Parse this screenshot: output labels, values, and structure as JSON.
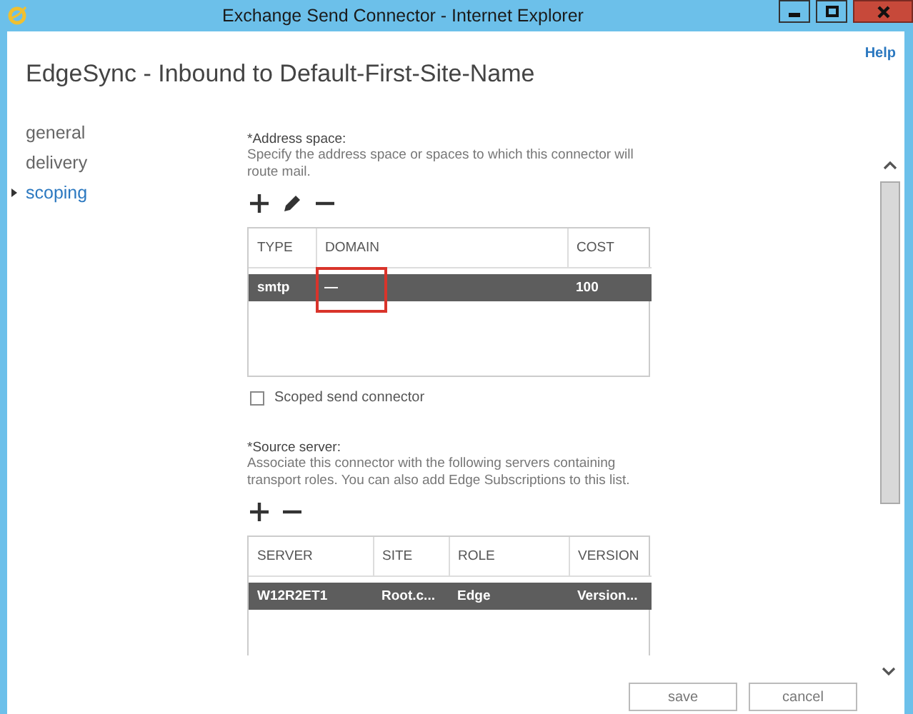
{
  "window": {
    "title": "Exchange Send Connector - Internet Explorer",
    "controls": [
      {
        "kind": "minimize"
      },
      {
        "kind": "maximize"
      },
      {
        "kind": "close"
      }
    ]
  },
  "help": "Help",
  "heading": "EdgeSync - Inbound to Default-First-Site-Name",
  "nav": [
    {
      "label": "general",
      "selected": false
    },
    {
      "label": "delivery",
      "selected": false
    },
    {
      "label": "scoping",
      "selected": true
    }
  ],
  "address_space": {
    "label": "*Address space:",
    "description": "Specify the address space or spaces to which this connector will route mail.",
    "toolbar": [
      {
        "kind": "add"
      },
      {
        "kind": "edit"
      },
      {
        "kind": "remove"
      }
    ],
    "columns": [
      "TYPE",
      "DOMAIN",
      "COST"
    ],
    "rows": [
      {
        "selected": true,
        "cells": [
          {
            "text": "smtp",
            "highlighted": false
          },
          {
            "text": "—",
            "highlighted": true
          },
          {
            "text": "100",
            "highlighted": false
          }
        ]
      }
    ]
  },
  "scoped": {
    "label": "Scoped send connector",
    "checked": false
  },
  "source_server": {
    "label": "*Source server:",
    "description": "Associate this connector with the following servers containing transport roles. You can also add Edge Subscriptions to this list.",
    "toolbar": [
      {
        "kind": "add"
      },
      {
        "kind": "remove"
      }
    ],
    "columns": [
      "SERVER",
      "SITE",
      "ROLE",
      "VERSION"
    ],
    "rows": [
      {
        "selected": true,
        "cells": [
          "W12R2ET1",
          "Root.c...",
          "Edge",
          "Version..."
        ]
      }
    ]
  },
  "buttons": [
    "save",
    "cancel"
  ]
}
